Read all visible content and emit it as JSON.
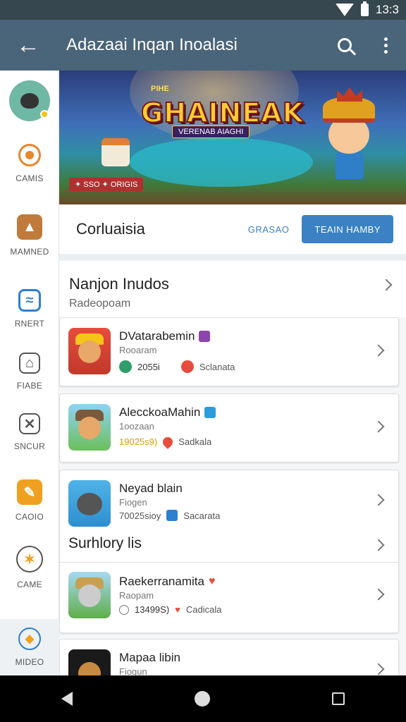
{
  "status_bar": {
    "time": "13:3"
  },
  "app_bar": {
    "title": "Adazaai Inqan Inoalasi"
  },
  "sidebar": {
    "items": [
      {
        "label": "CAMIS",
        "icon": "target-icon",
        "color": "#e9852c"
      },
      {
        "label": "MAMNED",
        "icon": "box-icon",
        "color": "#c07a3a"
      },
      {
        "label": "RNERT",
        "icon": "chart-icon",
        "color": "#2d7fd0"
      },
      {
        "label": "FIABE",
        "icon": "home-icon",
        "color": "#555555"
      },
      {
        "label": "SNCUR",
        "icon": "close-square-icon",
        "color": "#555555"
      },
      {
        "label": "CAOIO",
        "icon": "pencil-icon",
        "color": "#f0a020"
      },
      {
        "label": "CAME",
        "icon": "star-icon",
        "color": "#f0a020"
      },
      {
        "label": "MIDEO",
        "icon": "shield-icon",
        "color": "#f0a020"
      }
    ]
  },
  "banner": {
    "top_label": "PIHE",
    "logo": "GHAINEAK",
    "subtitle": "VERENAB AIAGHI",
    "tags": "✦ SSO  ✦ ORIGIS"
  },
  "section": {
    "title": "Corluaisia",
    "link": "GRASAO",
    "button": "TEAIN HAMBY"
  },
  "group1": {
    "title": "Nanjon Inudos",
    "subtitle": "Radeopoam"
  },
  "apps": [
    {
      "name": "DVatarabemin",
      "sub": "Rooaram",
      "value": "2055i",
      "extra": "Sclanata",
      "value_color": "#333333"
    },
    {
      "name": "AlecckoaMahin",
      "sub": "1oozaan",
      "value": "19025s9)",
      "extra": "Sadkala",
      "value_color": "#d89a1a"
    },
    {
      "name": "Neyad blain",
      "sub": "Fiogen",
      "value": "70025sioy",
      "extra": "Sacarata",
      "value_color": "#555555"
    }
  ],
  "group2": {
    "title": "Surhlory lis"
  },
  "apps2": [
    {
      "name": "Raekerranamita",
      "sub": "Raopam",
      "value": "13499S)",
      "extra": "Cadicala",
      "value_color": "#333333"
    },
    {
      "name": "Mapaa libin",
      "sub": "Fiogun"
    }
  ]
}
